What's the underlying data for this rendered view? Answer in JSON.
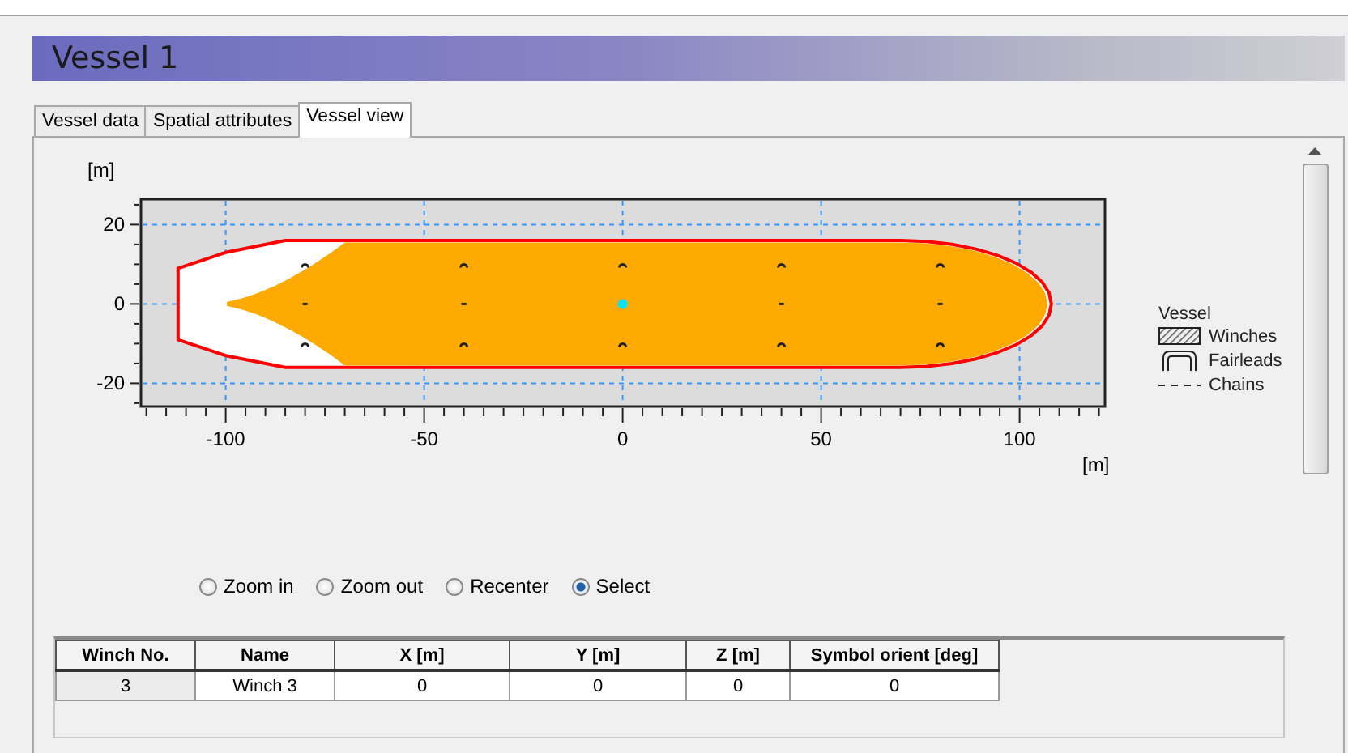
{
  "header": {
    "title": "Vessel 1"
  },
  "tabs": [
    {
      "label": "Vessel data",
      "selected": false
    },
    {
      "label": "Spatial attributes",
      "selected": false
    },
    {
      "label": "Vessel view",
      "selected": true
    }
  ],
  "plot": {
    "y_unit": "[m]",
    "x_unit": "[m]",
    "xticks": [
      "-100",
      "-50",
      "0",
      "50",
      "100"
    ],
    "yticks": [
      "20",
      "0",
      "-20"
    ]
  },
  "legend": {
    "title": "Vessel",
    "items": [
      {
        "kind": "winch",
        "label": "Winches"
      },
      {
        "kind": "fairlead",
        "label": "Fairleads"
      },
      {
        "kind": "chain",
        "label": "Chains"
      }
    ]
  },
  "modes": [
    {
      "label": "Zoom in",
      "selected": false
    },
    {
      "label": "Zoom out",
      "selected": false
    },
    {
      "label": "Recenter",
      "selected": false
    },
    {
      "label": "Select",
      "selected": true
    }
  ],
  "table": {
    "columns": [
      "Winch No.",
      "Name",
      "X [m]",
      "Y [m]",
      "Z [m]",
      "Symbol orient [deg]"
    ],
    "rows": [
      [
        "3",
        "Winch 3",
        "0",
        "0",
        "0",
        "0"
      ]
    ]
  }
}
